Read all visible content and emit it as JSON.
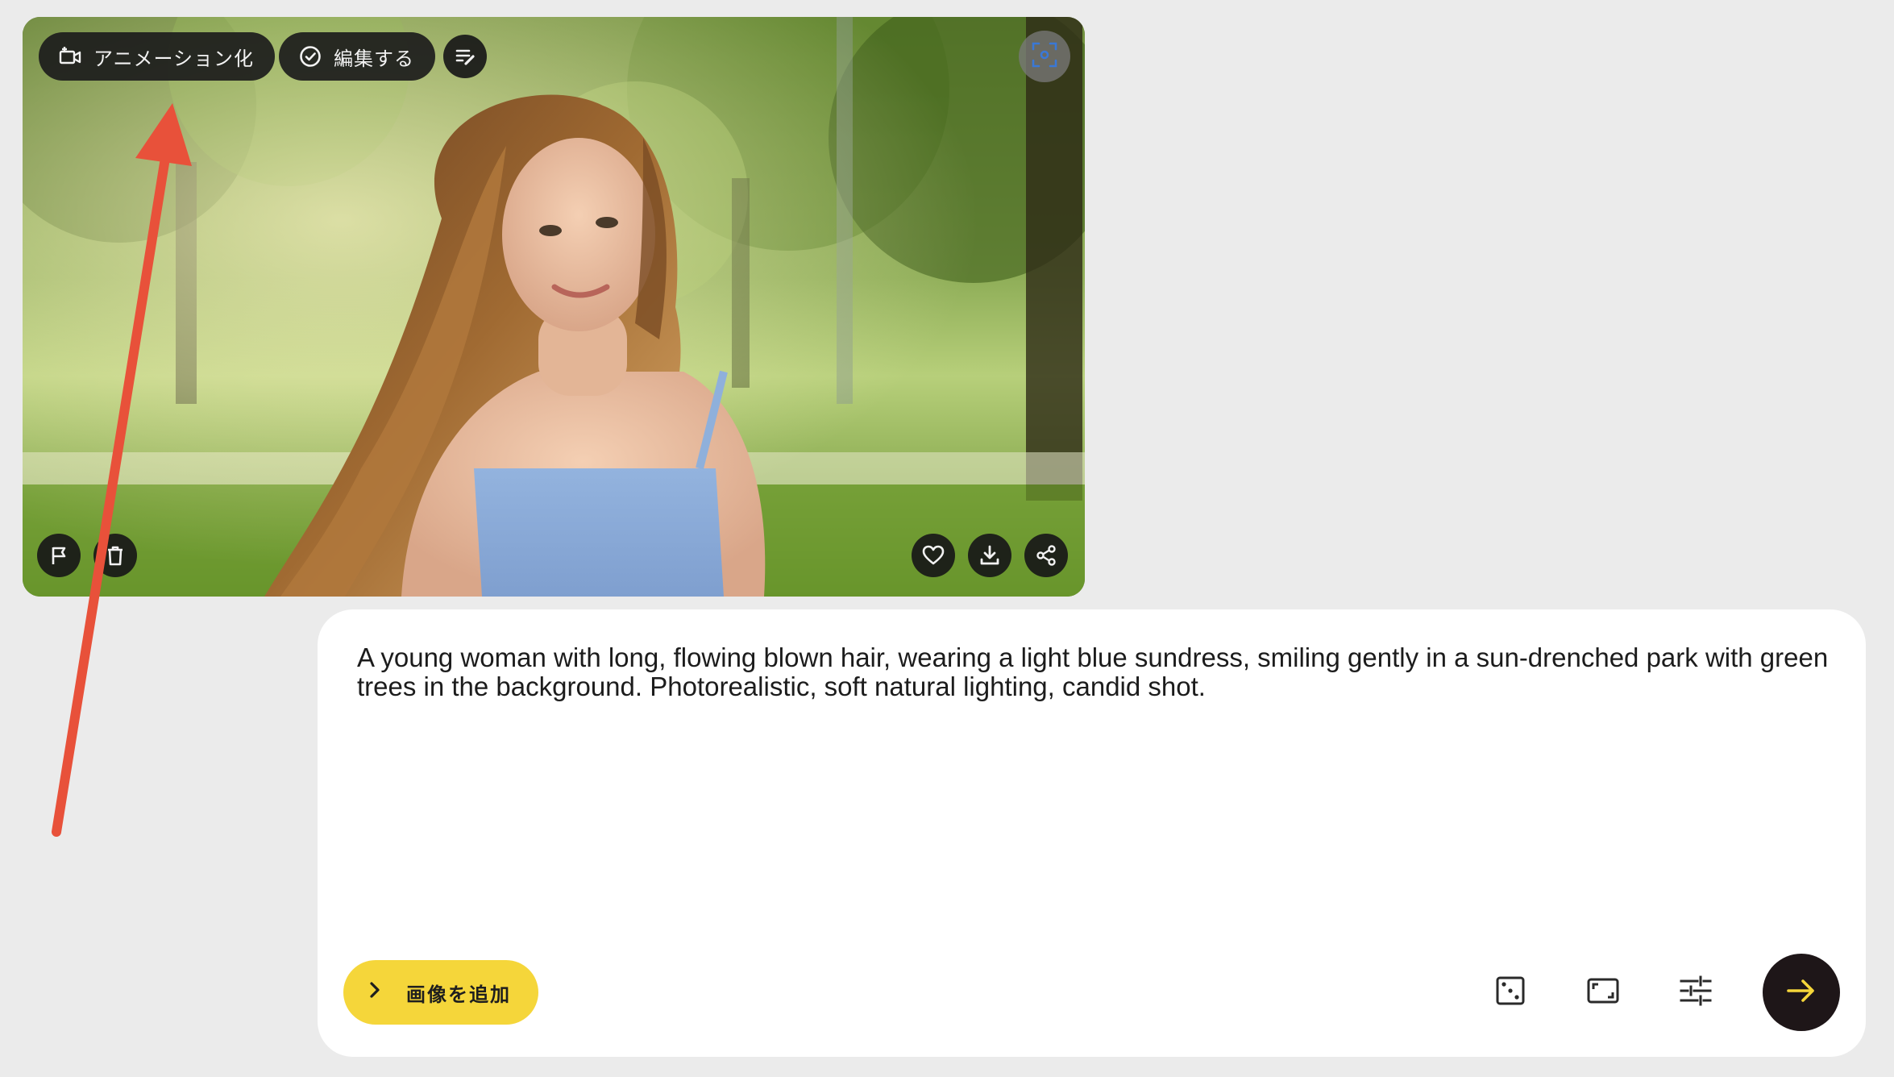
{
  "image_card": {
    "animate_label": "アニメーション化",
    "edit_label": "編集する",
    "icons": {
      "animate": "video-add-icon",
      "edit": "check-circle-icon",
      "notes": "edit-notes-icon",
      "focus": "center-focus-icon",
      "flag": "flag-icon",
      "delete": "trash-icon",
      "favorite": "heart-icon",
      "download": "download-icon",
      "share": "share-icon"
    }
  },
  "prompt": {
    "text": "A young woman with long, flowing blown hair, wearing a light blue sundress, smiling gently in a sun-drenched park with green trees in the background. Photorealistic, soft natural lighting, candid shot.",
    "add_image_label": "画像を追加",
    "icons": {
      "random": "dice-icon",
      "aspect": "aspect-ratio-icon",
      "settings": "tune-icon",
      "send": "arrow-right-icon"
    }
  },
  "colors": {
    "background": "#ebebeb",
    "accent_yellow": "#f5d63a",
    "send_button": "#1e1618",
    "annotation_arrow": "#e8513a",
    "pill_background": "#1c1c1c"
  }
}
